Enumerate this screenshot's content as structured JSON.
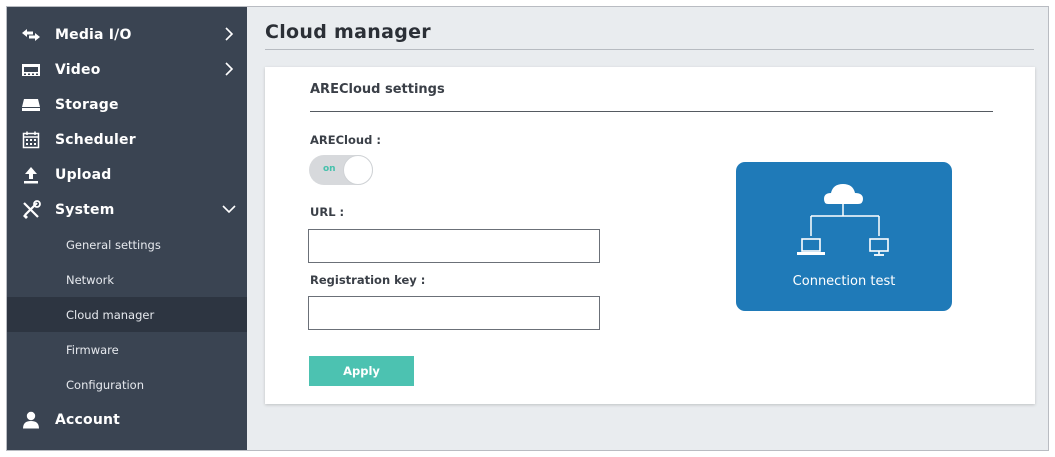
{
  "sidebar": {
    "items": [
      {
        "label": "Media I/O",
        "icon": "arrows-icon"
      },
      {
        "label": "Video",
        "icon": "film-icon"
      },
      {
        "label": "Storage",
        "icon": "drive-icon"
      },
      {
        "label": "Scheduler",
        "icon": "calendar-icon"
      },
      {
        "label": "Upload",
        "icon": "upload-icon"
      },
      {
        "label": "System",
        "icon": "tools-icon"
      },
      {
        "label": "Account",
        "icon": "user-icon"
      }
    ],
    "system_subitems": [
      {
        "label": "General settings"
      },
      {
        "label": "Network"
      },
      {
        "label": "Cloud manager",
        "active": true
      },
      {
        "label": "Firmware"
      },
      {
        "label": "Configuration"
      }
    ]
  },
  "page": {
    "title": "Cloud manager"
  },
  "card": {
    "heading": "ARECloud settings",
    "arecloud_label": "ARECloud :",
    "toggle_state_text": "on",
    "url_label": "URL :",
    "url_value": "",
    "regkey_label": "Registration key :",
    "regkey_value": "",
    "apply_label": "Apply",
    "connection_test_label": "Connection test"
  },
  "colors": {
    "sidebar_bg": "#3a4452",
    "sidebar_active_bg": "#2d3541",
    "accent_teal": "#4cc2b1",
    "connection_blue": "#1f7ab8"
  }
}
